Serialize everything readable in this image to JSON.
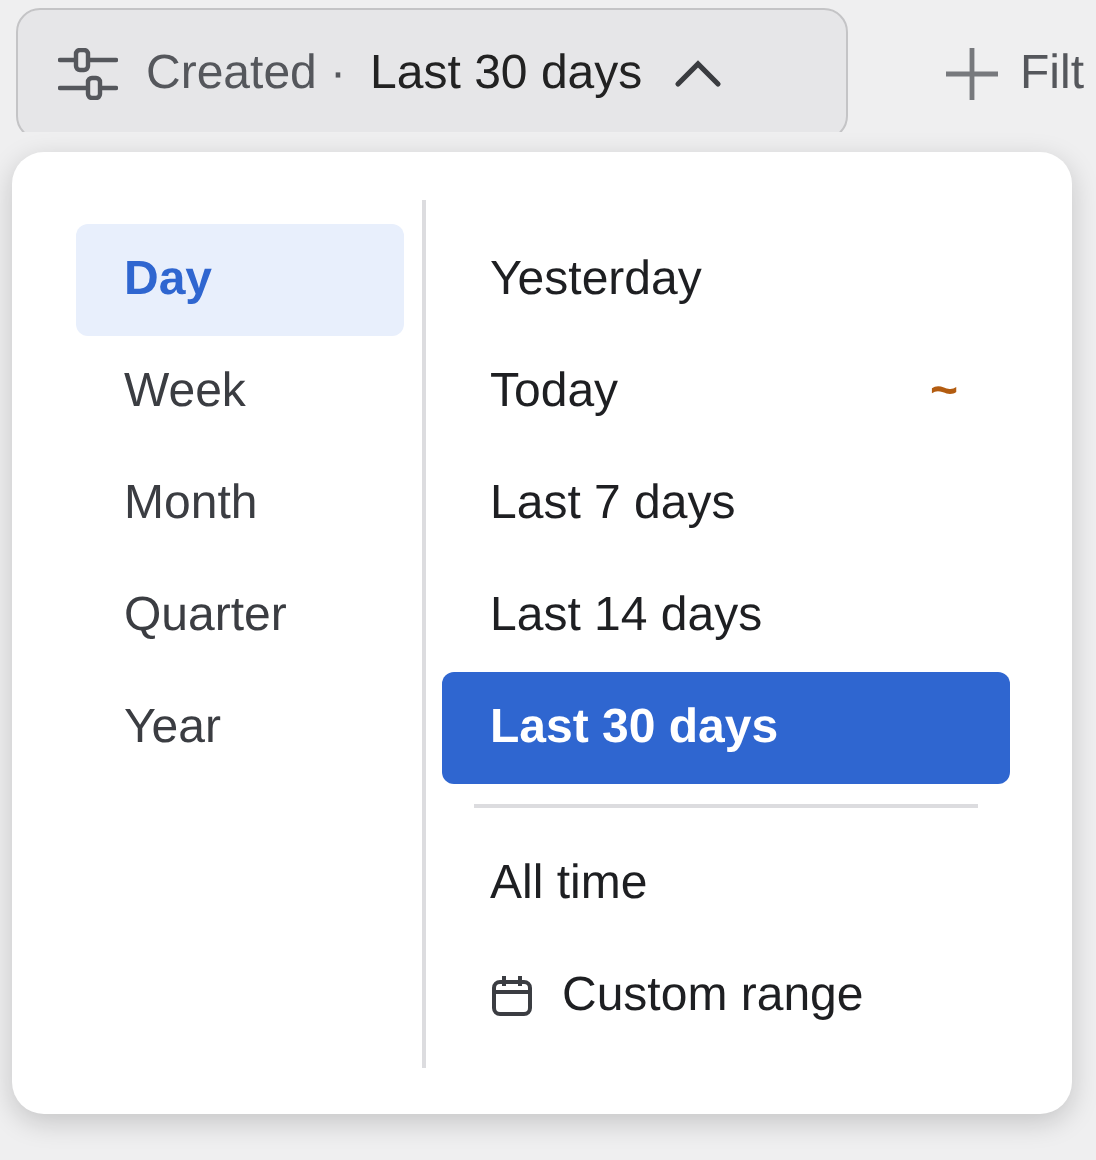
{
  "filter_button": {
    "label": "Created ·",
    "value": "Last 30 days",
    "expanded": true
  },
  "add_filter": {
    "label": "Filt"
  },
  "granularities": [
    {
      "label": "Day",
      "selected": true
    },
    {
      "label": "Week",
      "selected": false
    },
    {
      "label": "Month",
      "selected": false
    },
    {
      "label": "Quarter",
      "selected": false
    },
    {
      "label": "Year",
      "selected": false
    }
  ],
  "ranges": [
    {
      "label": "Yesterday",
      "selected": false
    },
    {
      "label": "Today",
      "selected": false,
      "marker": "~"
    },
    {
      "label": "Last 7 days",
      "selected": false
    },
    {
      "label": "Last 14 days",
      "selected": false
    },
    {
      "label": "Last 30 days",
      "selected": true
    }
  ],
  "extra_options": [
    {
      "kind": "option",
      "label": "All time"
    },
    {
      "kind": "custom",
      "label": "Custom range"
    }
  ]
}
